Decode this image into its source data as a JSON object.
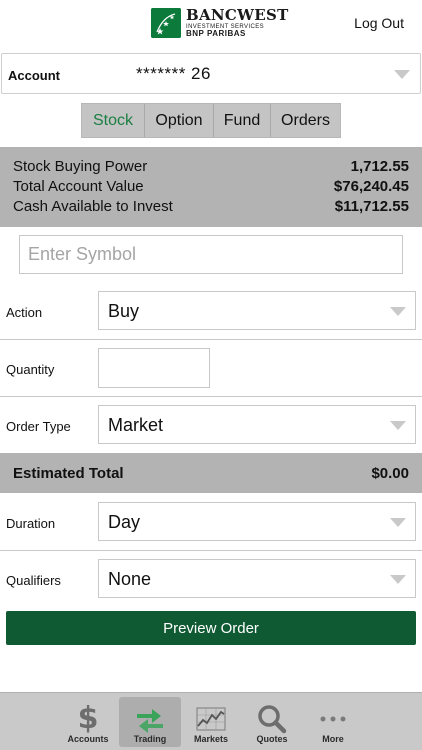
{
  "header": {
    "logo_title": "BANCWEST",
    "logo_sub1": "INVESTMENT SERVICES",
    "logo_sub2": "BNP PARIBAS",
    "logout_label": "Log Out"
  },
  "account": {
    "label": "Account",
    "value": "******* 26"
  },
  "tabs": [
    {
      "label": "Stock",
      "active": true
    },
    {
      "label": "Option",
      "active": false
    },
    {
      "label": "Fund",
      "active": false
    },
    {
      "label": "Orders",
      "active": false
    }
  ],
  "summary": {
    "rows": [
      {
        "label": "Stock Buying Power",
        "value": "1,712.55"
      },
      {
        "label": "Total Account Value",
        "value": "$76,240.45"
      },
      {
        "label": "Cash Available to Invest",
        "value": "$11,712.55"
      }
    ]
  },
  "symbol": {
    "placeholder": "Enter Symbol"
  },
  "form": {
    "action_label": "Action",
    "action_value": "Buy",
    "quantity_label": "Quantity",
    "quantity_value": "",
    "order_type_label": "Order Type",
    "order_type_value": "Market",
    "duration_label": "Duration",
    "duration_value": "Day",
    "qualifiers_label": "Qualifiers",
    "qualifiers_value": "None"
  },
  "estimated_total": {
    "label": "Estimated Total",
    "value": "$0.00"
  },
  "preview_button": {
    "label": "Preview Order"
  },
  "bottom_nav": {
    "items": [
      {
        "label": "Accounts",
        "icon": "dollar-icon"
      },
      {
        "label": "Trading",
        "icon": "trading-arrows-icon"
      },
      {
        "label": "Markets",
        "icon": "markets-chart-icon"
      },
      {
        "label": "Quotes",
        "icon": "search-icon"
      },
      {
        "label": "More",
        "icon": "more-dots-icon"
      }
    ]
  },
  "colors": {
    "brand_green": "#0f5a33",
    "active_tab_text": "#1b7f43",
    "summary_bg": "#b3b3b3"
  }
}
